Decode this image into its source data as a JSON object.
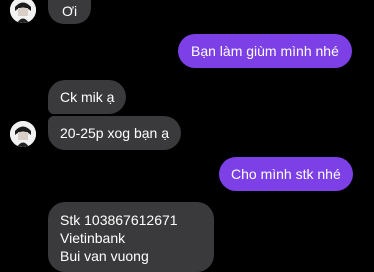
{
  "conversation": {
    "messages": [
      {
        "direction": "incoming",
        "text": "Ơi"
      },
      {
        "direction": "outgoing",
        "text": "Bạn làm giùm mình nhé"
      },
      {
        "direction": "incoming",
        "text": "Ck mik ạ"
      },
      {
        "direction": "incoming",
        "text": "20-25p xog bạn ạ"
      },
      {
        "direction": "outgoing",
        "text": "Cho mình stk nhé"
      },
      {
        "direction": "incoming",
        "lines": [
          "Stk 103867612671",
          "Vietinbank",
          "Bui van vuong"
        ]
      }
    ]
  },
  "colors": {
    "background": "#000000",
    "incoming_bubble": "#3a3a3c",
    "outgoing_bubble": "#7d3fe6",
    "text": "#ffffff"
  },
  "icons": {
    "contact_avatar": "avatar-icon"
  }
}
